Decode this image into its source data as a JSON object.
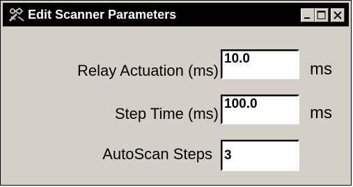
{
  "window": {
    "title": "Edit Scanner Parameters",
    "icon": "scanner-wrench-icon",
    "controls": {
      "minimize": "minimize-icon",
      "maximize": "maximize-icon",
      "close": "close-icon"
    }
  },
  "fields": [
    {
      "label": "Relay Actuation (ms)",
      "value": "10.0",
      "unit": "ms"
    },
    {
      "label": "Step Time (ms)",
      "value": "100.0",
      "unit": "ms"
    },
    {
      "label": "AutoScan Steps",
      "value": "3",
      "unit": ""
    }
  ],
  "colors": {
    "titlebar_bg": "#000000",
    "window_bg": "#d4d0c8",
    "field_bg": "#ffffff"
  }
}
